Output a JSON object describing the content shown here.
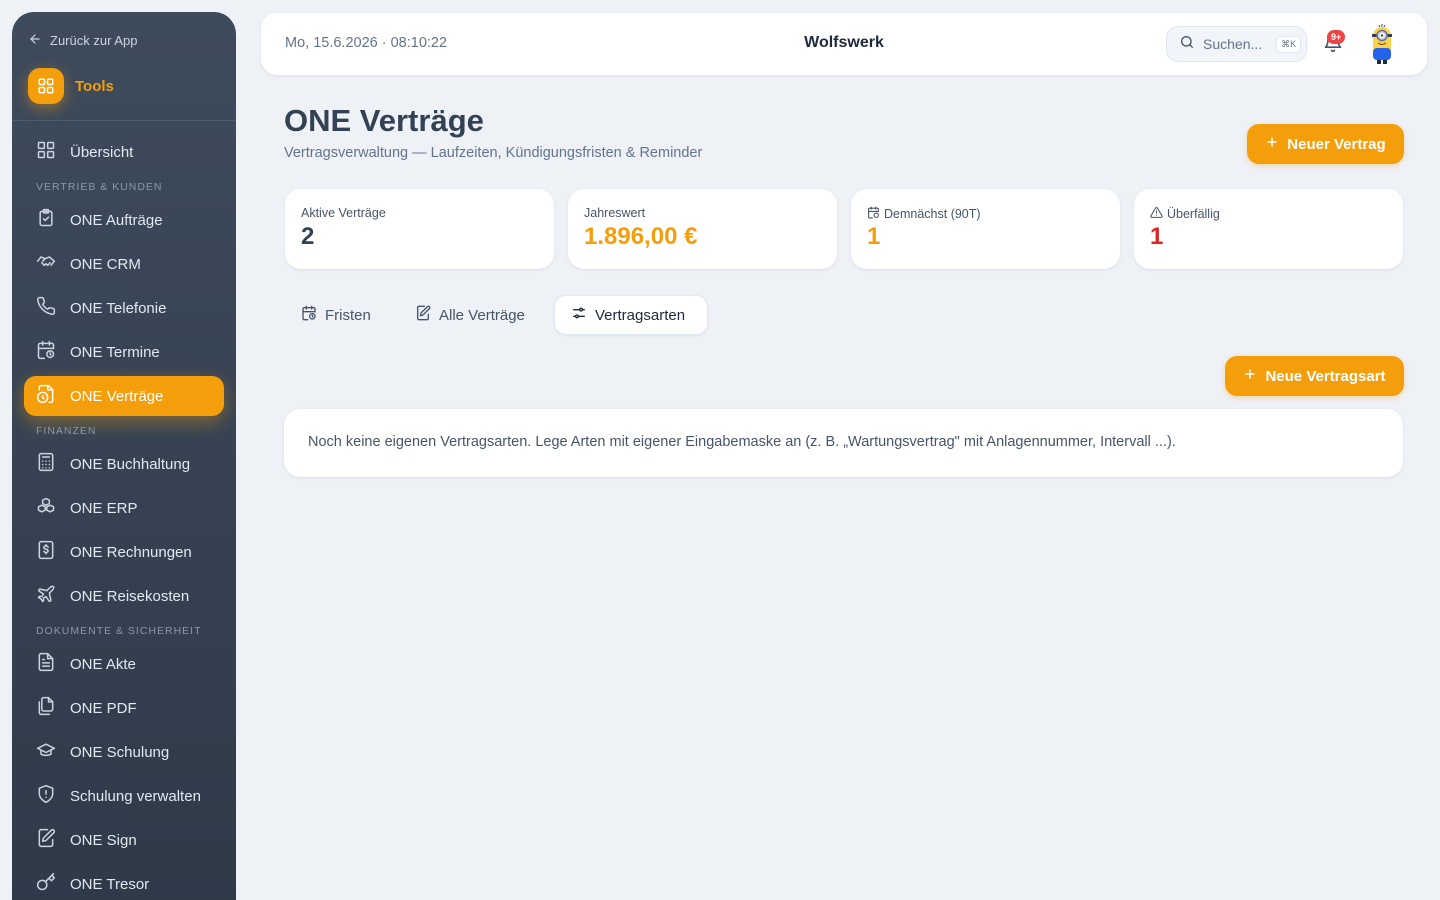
{
  "sidebar": {
    "back_label": "Zurück zur App",
    "tools_label": "Tools",
    "overview_label": "Übersicht",
    "sections": {
      "sales": "VERTRIEB & KUNDEN",
      "finance": "FINANZEN",
      "documents": "DOKUMENTE & SICHERHEIT"
    },
    "items": {
      "auftraege": "ONE Aufträge",
      "crm": "ONE CRM",
      "telefonie": "ONE Telefonie",
      "termine": "ONE Termine",
      "vertraege": "ONE Verträge",
      "buchhaltung": "ONE Buchhaltung",
      "erp": "ONE ERP",
      "rechnungen": "ONE Rechnungen",
      "reisekosten": "ONE Reisekosten",
      "akte": "ONE Akte",
      "pdf": "ONE PDF",
      "schulung": "ONE Schulung",
      "schulung_verwalten": "Schulung verwalten",
      "sign": "ONE Sign",
      "tresor": "ONE Tresor"
    },
    "active_item": "vertraege"
  },
  "topbar": {
    "datetime": "Mo, 15.6.2026 · 08:10:22",
    "brand": "Wolfswerk",
    "search_placeholder": "Suchen...",
    "search_shortcut": "⌘K",
    "notification_badge": "9+"
  },
  "header": {
    "title": "ONE Verträge",
    "subtitle": "Vertragsverwaltung — Laufzeiten, Kündigungsfristen & Reminder",
    "new_contract_label": "Neuer Vertrag"
  },
  "stats": [
    {
      "label": "Aktive Verträge",
      "value": "2",
      "color": "#334155"
    },
    {
      "label": "Jahreswert",
      "value": "1.896,00 €",
      "color": "#f59e0b"
    },
    {
      "label": "Demnächst (90T)",
      "value": "1",
      "color": "#f59e0b"
    },
    {
      "label": "Überfällig",
      "value": "1",
      "color": "#dc2626"
    }
  ],
  "tabs": {
    "fristen": "Fristen",
    "alle": "Alle Verträge",
    "arten": "Vertragsarten",
    "active": "arten"
  },
  "content": {
    "new_type_label": "Neue Vertragsart",
    "empty_message": "Noch keine eigenen Vertragsarten. Lege Arten mit eigener Eingabemaske an (z. B. „Wartungsvertrag\" mit Anlagennummer, Intervall ...)."
  },
  "colors": {
    "accent": "#f59e0b",
    "sidebar_bg": "#36424f",
    "danger": "#dc2626"
  }
}
